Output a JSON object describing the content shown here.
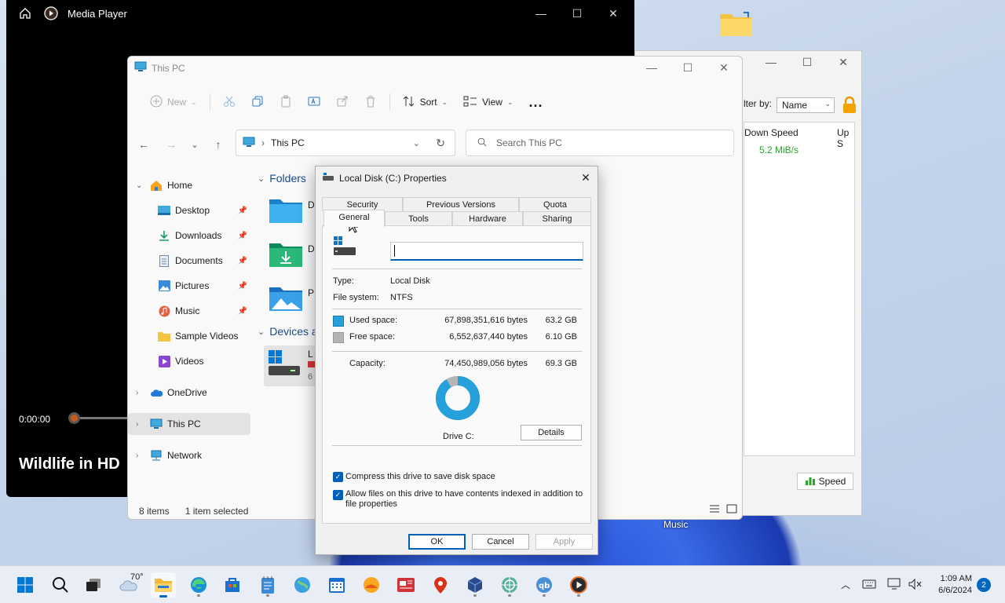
{
  "media": {
    "title": "Media Player",
    "time": "0:00:00",
    "video_title": "Wildlife in HD"
  },
  "qbt": {
    "filter_label": "lter by:",
    "filter_value": "Name",
    "col_down": "Down Speed",
    "col_up": "Up S",
    "down_speed": "5.2 MiB/s",
    "speed_button": "Speed"
  },
  "explorer": {
    "title": "This PC",
    "toolbar": {
      "new": "New",
      "sort": "Sort",
      "view": "View",
      "more": "..."
    },
    "address": "This PC",
    "search_placeholder": "Search This PC",
    "sidebar": [
      {
        "label": "Home"
      },
      {
        "label": "Desktop"
      },
      {
        "label": "Downloads"
      },
      {
        "label": "Documents"
      },
      {
        "label": "Pictures"
      },
      {
        "label": "Music"
      },
      {
        "label": "Sample Videos"
      },
      {
        "label": "Videos"
      },
      {
        "label": "OneDrive"
      },
      {
        "label": "This PC"
      },
      {
        "label": "Network"
      }
    ],
    "sections": {
      "folders": "Folders",
      "devices": "Devices a"
    },
    "folder_letters": [
      "D",
      "D",
      "P"
    ],
    "device_letter": "L",
    "device_sub": "6",
    "status_items": "8 items",
    "status_selected": "1 item selected"
  },
  "dialog": {
    "title": "Local Disk (C:) Properties",
    "tabs_top": [
      "Security",
      "Previous Versions",
      "Quota"
    ],
    "tabs_bottom": [
      "General",
      "Tools",
      "Hardware",
      "Sharing"
    ],
    "type_label": "Type:",
    "type_value": "Local Disk",
    "fs_label": "File system:",
    "fs_value": "NTFS",
    "used_label": "Used space:",
    "used_bytes": "67,898,351,616 bytes",
    "used_gb": "63.2 GB",
    "free_label": "Free space:",
    "free_bytes": "6,552,637,440 bytes",
    "free_gb": "6.10 GB",
    "cap_label": "Capacity:",
    "cap_bytes": "74,450,989,056 bytes",
    "cap_gb": "69.3 GB",
    "used_fraction": 0.912,
    "drive_label": "Drive C:",
    "details": "Details",
    "compress": "Compress this drive to save disk space",
    "index_line1": "Allow files on this drive to have contents indexed in addition to",
    "index_line2": "file properties",
    "ok": "OK",
    "cancel": "Cancel",
    "apply": "Apply",
    "colors": {
      "used": "#26a0da",
      "free": "#b4b4b4"
    }
  },
  "desktop": {
    "music_label": "Music"
  },
  "taskbar": {
    "weather_temp": "70°",
    "time": "1:09 AM",
    "date": "6/6/2024",
    "notifications": "2"
  }
}
